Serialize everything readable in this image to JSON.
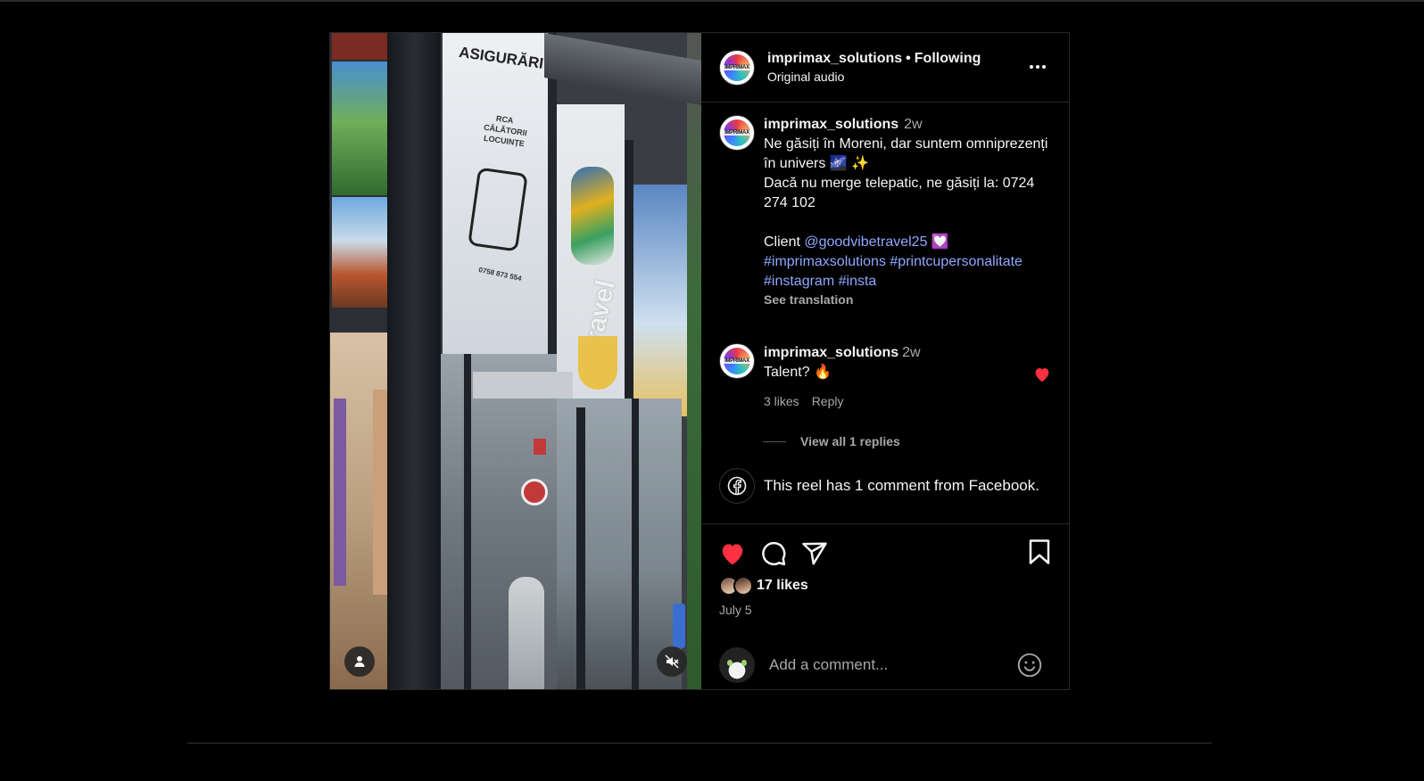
{
  "post": {
    "username": "imprimax_solutions",
    "avatar_text": "IMPRIMAX",
    "separator": "•",
    "follow_status": "Following",
    "audio": "Original audio"
  },
  "caption": {
    "username": "imprimax_solutions",
    "time": "2w",
    "line1": "Ne găsiți în Moreni, dar suntem omniprezenți în univers 🌌 ✨",
    "line2": "Dacă nu merge telepatic, ne găsiți la: 0724 274 102",
    "client_label": "Client",
    "mention": "@goodvibetravel25",
    "mention_emoji": "💟",
    "hashtags": [
      "#imprimaxsolutions",
      "#printcupersonalitate",
      "#instagram",
      "#insta"
    ],
    "see_translation": "See translation"
  },
  "comment": {
    "username": "imprimax_solutions",
    "time": "2w",
    "text": "Talent? 🔥",
    "likes": "3 likes",
    "reply": "Reply",
    "view_replies": "View all 1 replies"
  },
  "facebook_note": "This reel has 1 comment from Facebook.",
  "likes": "17 likes",
  "date": "July 5",
  "add_comment_placeholder": "Add a comment...",
  "media": {
    "sign_top": "ASIGURĂRI",
    "sign_sub1": "RCA",
    "sign_sub2": "CĂLĂTORII",
    "sign_sub3": "LOCUINȚE",
    "sign_phone": "0758 873 554",
    "travel_text": "travel"
  },
  "colors": {
    "like_red": "#ff3040",
    "link_blue": "#8fa8ff",
    "muted": "#a8a8a8"
  },
  "icons": [
    "user-icon",
    "mute-icon",
    "more-icon",
    "heart-icon",
    "comment-icon",
    "share-icon",
    "bookmark-icon",
    "facebook-icon",
    "emoji-icon"
  ]
}
